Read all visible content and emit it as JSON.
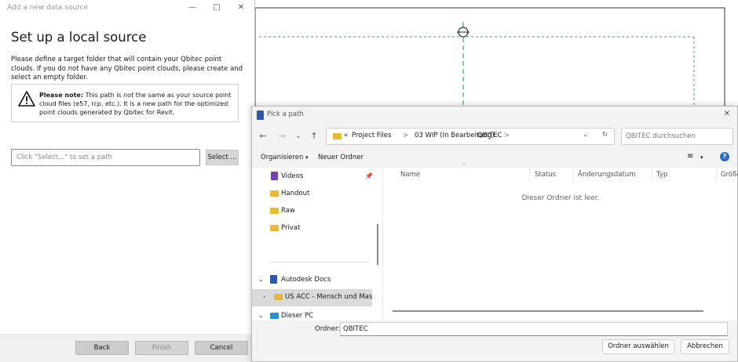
{
  "wizard": {
    "title": "Add a new data source",
    "heading": "Set up a local source",
    "description": "Please define a target folder that will contain your Qbitec point clouds. If you do not have any Qbitec point clouds, please create and select an empty folder.",
    "note_bold": "Please note:",
    "note_part1": " This path is ",
    "note_italic": "not",
    "note_part2": " the same as your source point cloud files (e57, rcp, etc.). It is a new path for the optimized point clouds generated by Qbitec for Revit.",
    "path_placeholder": "Click \"Select...\" to set a path",
    "select_label": "Select ...",
    "back_label": "Back",
    "finish_label": "Finish",
    "cancel_label": "Cancel"
  },
  "picker": {
    "title": "Pick a path",
    "breadcrumbs": [
      "«",
      "Project Files",
      ">",
      "03 WIP (In Bearbeitung)",
      ">",
      "QBITEC"
    ],
    "search_placeholder": "QBITEC durchsuchen",
    "organize_label": "Organisieren",
    "new_folder_label": "Neuer Ordner",
    "nav_items": [
      {
        "label": "Videos",
        "icon": "videos-folder-icon",
        "color": "#7b3fb6"
      },
      {
        "label": "Handout",
        "icon": "folder-icon",
        "color": "#e9b83a"
      },
      {
        "label": "Raw",
        "icon": "folder-icon",
        "color": "#e9b83a"
      },
      {
        "label": "Privat",
        "icon": "folder-icon",
        "color": "#e9b83a"
      },
      {
        "label": "Autodesk Docs",
        "icon": "autodesk-docs-icon",
        "color": "#2f57a8"
      },
      {
        "label": "US ACC - Mensch und Maschine",
        "icon": "folder-icon",
        "color": "#e9b83a"
      },
      {
        "label": "Dieser PC",
        "icon": "pc-icon",
        "color": "#2a8fd6"
      }
    ],
    "columns": [
      "Name",
      "Status",
      "Änderungsdatum",
      "Typ",
      "Größe"
    ],
    "empty_message": "Dieser Ordner ist leer.",
    "folder_label": "Ordner:",
    "folder_value": "QBITEC",
    "select_folder_label": "Ordner auswählen",
    "cancel_label": "Abbrechen"
  }
}
